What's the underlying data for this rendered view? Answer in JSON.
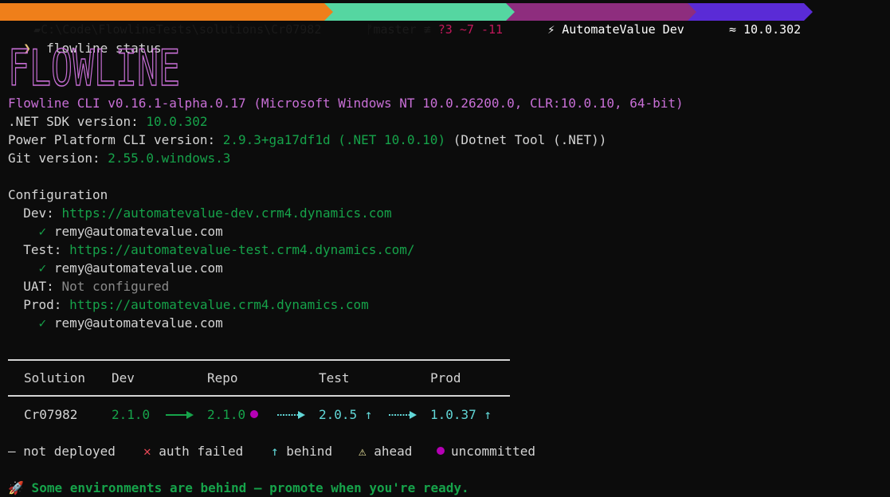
{
  "prompt": {
    "path": "C:\\Code\\FlowlineTests\\solutions\\Cr07982",
    "branch": "master ≢",
    "git_status": "?3 ~7 -11",
    "app_label": "AutomateValue Dev",
    "sdk_label": "10.0.302",
    "symbol": "❯",
    "command": "flowline status"
  },
  "logo_text": "FLOWLINE",
  "version_line": "Flowline CLI v0.16.1-alpha.0.17 (Microsoft Windows NT 10.0.26200.0, CLR:10.0.10, 64-bit)",
  "tools": {
    "dotnet_label": ".NET SDK version: ",
    "dotnet_value": "10.0.302",
    "pac_label": "Power Platform CLI version: ",
    "pac_value": "2.9.3+ga17df1d (.NET 10.0.10)",
    "pac_suffix": " (Dotnet Tool (.NET))",
    "git_label": "Git version: ",
    "git_value": "2.55.0.windows.3"
  },
  "config": {
    "heading": "Configuration",
    "dev_label": "Dev: ",
    "dev_url": "https://automatevalue-dev.crm4.dynamics.com",
    "dev_user": "remy@automatevalue.com",
    "test_label": "Test: ",
    "test_url": "https://automatevalue-test.crm4.dynamics.com/",
    "test_user": "remy@automatevalue.com",
    "uat_label": "UAT: ",
    "uat_value": "Not configured",
    "prod_label": "Prod: ",
    "prod_url": "https://automatevalue.crm4.dynamics.com",
    "prod_user": "remy@automatevalue.com",
    "check": "✓"
  },
  "table": {
    "headers": [
      "Solution",
      "Dev",
      "Repo",
      "Test",
      "Prod"
    ],
    "row": {
      "solution": "Cr07982",
      "dev": "2.1.0",
      "repo": "2.1.0",
      "test": "2.0.5 ↑",
      "prod": "1.0.37 ↑"
    }
  },
  "legend": {
    "not_deployed": "— not deployed",
    "auth_failed_icon": "✕",
    "auth_failed": " auth failed",
    "behind_icon": "↑",
    "behind": " behind",
    "ahead_icon": "⚠",
    "ahead": " ahead",
    "uncommitted": "uncommitted"
  },
  "footer": {
    "icon": "🚀",
    "message": " Some environments are behind — promote when you're ready."
  },
  "colors": {
    "pink": "#c86fd6",
    "green": "#16a34a",
    "cyan": "#61d6d6",
    "magenta_dot": "#b500b5",
    "red": "#e74856",
    "yellow": "#f9f1a5"
  }
}
